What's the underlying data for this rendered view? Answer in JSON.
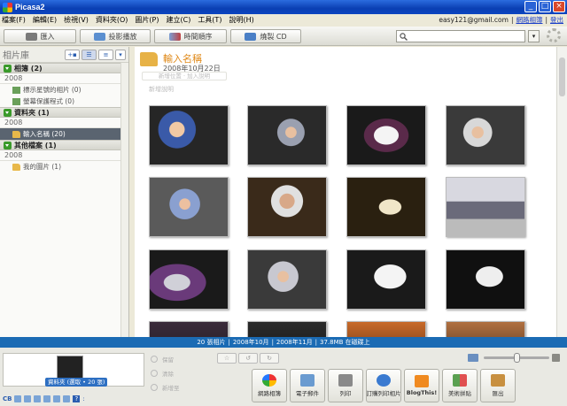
{
  "window": {
    "title": "Picasa2"
  },
  "menu": {
    "items": [
      "檔案(F)",
      "編輯(E)",
      "檢視(V)",
      "資料夾(O)",
      "圖片(P)",
      "建立(C)",
      "工具(T)",
      "說明(H)"
    ],
    "account": "easy121@gmail.com",
    "web_albums": "網路相簿",
    "sign_out": "登出"
  },
  "toolbar": {
    "import": "匯入",
    "slideshow": "投影播放",
    "timeline": "時間順序",
    "burn_cd": "燒製 CD",
    "search_placeholder": ""
  },
  "library": {
    "heading": "相片庫",
    "groups": [
      {
        "label": "相簿 (2)",
        "year": "2008",
        "items": [
          {
            "label": "標示星號的相片 (0)",
            "icon": "star-icon"
          },
          {
            "label": "螢幕保護程式 (0)",
            "icon": "screensaver-icon"
          }
        ]
      },
      {
        "label": "資料夾 (1)",
        "year": "2008",
        "items": [
          {
            "label": "輸入名稱 (20)",
            "icon": "folder-icon",
            "selected": true
          }
        ]
      },
      {
        "label": "其他檔案 (1)",
        "year": "2008",
        "items": [
          {
            "label": "我的圖片 (1)",
            "icon": "folder-icon"
          }
        ]
      }
    ]
  },
  "album": {
    "title": "輸入名稱",
    "date": "2008年10月22日",
    "add_location": "新增位置 · 加入說明",
    "add_description": "新增說明"
  },
  "status": {
    "count": "20 張相片",
    "date_from": "2008年10月",
    "date_to": "2008年11月",
    "size": "37.8MB 在磁碟上"
  },
  "tray": {
    "selection_label": "資料夾 (選取 • 20 張)",
    "hold": "保留",
    "clear": "清除",
    "add_to": "新增至"
  },
  "actions": [
    {
      "label": "網路相簿",
      "color": "#4a8ad6"
    },
    {
      "label": "電子郵件",
      "color": "#6a9bd0"
    },
    {
      "label": "列印",
      "color": "#8a8a8a"
    },
    {
      "label": "訂購列印相片",
      "color": "#3a7ad0"
    },
    {
      "label": "BlogThis!",
      "color": "#f08a20"
    },
    {
      "label": "美術拼貼",
      "color": "#5aa050"
    },
    {
      "label": "匯出",
      "color": "#c89040"
    }
  ]
}
